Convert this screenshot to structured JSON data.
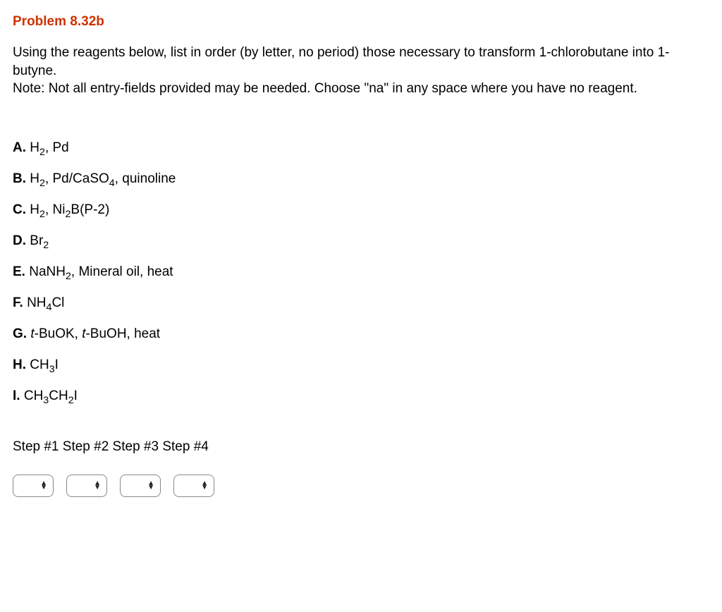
{
  "title": "Problem 8.32b",
  "instructions_line1": "Using the reagents below, list in order (by letter, no period) those necessary to transform 1-chlorobutane into 1-butyne.",
  "instructions_line2": "Note: Not all entry-fields provided may be needed. Choose \"na\" in any space where you have no reagent.",
  "reagents": {
    "A": {
      "letter": "A.",
      "html": "H<sub>2</sub>, Pd"
    },
    "B": {
      "letter": "B.",
      "html": "H<sub>2</sub>, Pd/CaSO<sub>4</sub>, quinoline"
    },
    "C": {
      "letter": "C.",
      "html": "H<sub>2</sub>, Ni<sub>2</sub>B(P-2)"
    },
    "D": {
      "letter": "D.",
      "html": "Br<sub>2</sub>"
    },
    "E": {
      "letter": "E.",
      "html": "NaNH<sub>2</sub>, Mineral oil, heat"
    },
    "F": {
      "letter": "F.",
      "html": "NH<sub>4</sub>Cl"
    },
    "G": {
      "letter": "G.",
      "html": "<span class=\"italic\">t</span>-BuOK, <span class=\"italic\">t</span>-BuOH, heat"
    },
    "H": {
      "letter": "H.",
      "html": "CH<sub>3</sub>I"
    },
    "I": {
      "letter": "I.",
      "html": "CH<sub>3</sub>CH<sub>2</sub>I"
    }
  },
  "steps_label": "Step #1 Step #2 Step #3 Step #4",
  "step_count": 4
}
